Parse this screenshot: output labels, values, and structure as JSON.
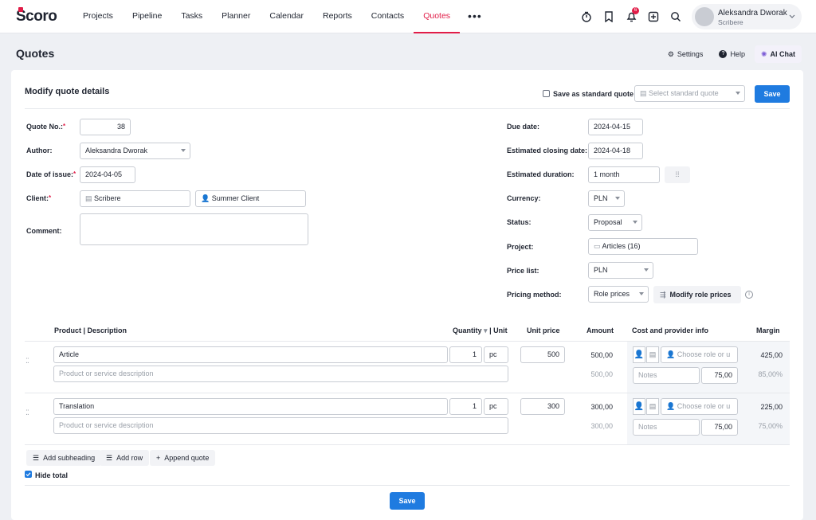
{
  "app": {
    "logo": "Scoro"
  },
  "nav": {
    "items": [
      {
        "label": "Projects"
      },
      {
        "label": "Pipeline"
      },
      {
        "label": "Tasks"
      },
      {
        "label": "Planner"
      },
      {
        "label": "Calendar"
      },
      {
        "label": "Reports"
      },
      {
        "label": "Contacts"
      },
      {
        "label": "Quotes",
        "active": true
      }
    ],
    "more": "•••"
  },
  "topbar": {
    "icons": [
      "timer-icon",
      "bookmark-icon",
      "bell-icon",
      "add-icon",
      "search-icon"
    ],
    "notification_count": "6",
    "user": {
      "name": "Aleksandra Dworak",
      "org": "Scribere"
    }
  },
  "page": {
    "title": "Quotes",
    "actions": {
      "settings": "Settings",
      "help": "Help",
      "ai_chat": "AI Chat"
    }
  },
  "form": {
    "heading": "Modify quote details",
    "save_as_standard": "Save as standard quote",
    "standard_placeholder": "Select standard quote",
    "save": "Save",
    "left": {
      "quote_no_label": "Quote No.:",
      "quote_no": "38",
      "author_label": "Author:",
      "author": "Aleksandra Dworak",
      "date_label": "Date of issue:",
      "date": "2024-04-05",
      "client_label": "Client:",
      "client": "Scribere",
      "contact": "Summer Client",
      "comment_label": "Comment:",
      "comment": ""
    },
    "right": {
      "due_label": "Due date:",
      "due": "2024-04-15",
      "closing_label": "Estimated closing date:",
      "closing": "2024-04-18",
      "duration_label": "Estimated duration:",
      "duration": "1 month",
      "currency_label": "Currency:",
      "currency": "PLN",
      "status_label": "Status:",
      "status": "Proposal",
      "project_label": "Project:",
      "project": "Articles (16)",
      "pricelist_label": "Price list:",
      "pricelist": "PLN",
      "pricing_label": "Pricing method:",
      "pricing": "Role prices",
      "modify_role_prices": "Modify role prices"
    }
  },
  "table": {
    "headers": {
      "product": "Product | Description",
      "quantity": "Quantity",
      "unit": "| Unit",
      "unit_price": "Unit price",
      "amount": "Amount",
      "cost": "Cost and provider info",
      "margin": "Margin"
    },
    "rows": [
      {
        "product": "Article",
        "description_placeholder": "Product or service description",
        "qty": "1",
        "unit": "pc",
        "unit_price": "500",
        "amount": "500,00",
        "amount2": "500,00",
        "role_placeholder": "Choose role or u",
        "notes_placeholder": "Notes",
        "cost": "75,00",
        "margin": "425,00",
        "margin_pct": "85,00%"
      },
      {
        "product": "Translation",
        "description_placeholder": "Product or service description",
        "qty": "1",
        "unit": "pc",
        "unit_price": "300",
        "amount": "300,00",
        "amount2": "300,00",
        "role_placeholder": "Choose role or u",
        "notes_placeholder": "Notes",
        "cost": "75,00",
        "margin": "225,00",
        "margin_pct": "75,00%"
      }
    ]
  },
  "footer": {
    "add_subheading": "Add subheading",
    "add_row": "Add row",
    "append_quote": "Append quote",
    "hide_total": "Hide total",
    "save": "Save"
  }
}
